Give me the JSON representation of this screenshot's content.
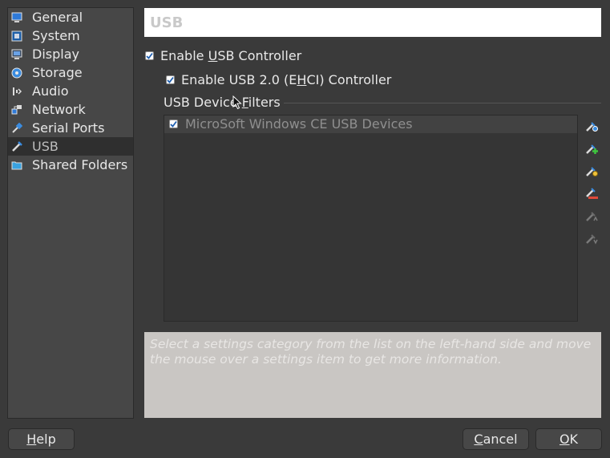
{
  "sidebar": {
    "items": [
      {
        "label": "General",
        "icon": "monitor-icon"
      },
      {
        "label": "System",
        "icon": "motherboard-icon"
      },
      {
        "label": "Display",
        "icon": "display-icon"
      },
      {
        "label": "Storage",
        "icon": "storage-icon"
      },
      {
        "label": "Audio",
        "icon": "audio-icon"
      },
      {
        "label": "Network",
        "icon": "network-icon"
      },
      {
        "label": "Serial Ports",
        "icon": "serial-port-icon"
      },
      {
        "label": "USB",
        "icon": "usb-icon"
      },
      {
        "label": "Shared Folders",
        "icon": "folder-icon"
      }
    ],
    "selected": "USB"
  },
  "header": {
    "title": "USB"
  },
  "usb": {
    "enable_controller": {
      "pre": "Enable ",
      "u": "U",
      "post": "SB Controller",
      "checked": true
    },
    "enable_ehci": {
      "pre": "Enable USB 2.0 (E",
      "u": "H",
      "post": "CI) Controller",
      "checked": true
    },
    "filters_title": {
      "pre": "USB Device ",
      "u": "F",
      "post": "ilters"
    },
    "filters": [
      {
        "label": "MicroSoft Windows CE USB Devices",
        "checked": true
      }
    ]
  },
  "info": {
    "text": "Select a settings category from the list on the left-hand side and move the mouse over a settings item to get more information."
  },
  "buttons": {
    "help": {
      "u": "H",
      "post": "elp"
    },
    "cancel": {
      "u": "C",
      "post": "ancel"
    },
    "ok": {
      "u": "O",
      "post": "K"
    }
  },
  "colors": {
    "window_bg": "#3a3a3a",
    "accent_blue": "#3a7bd5"
  }
}
